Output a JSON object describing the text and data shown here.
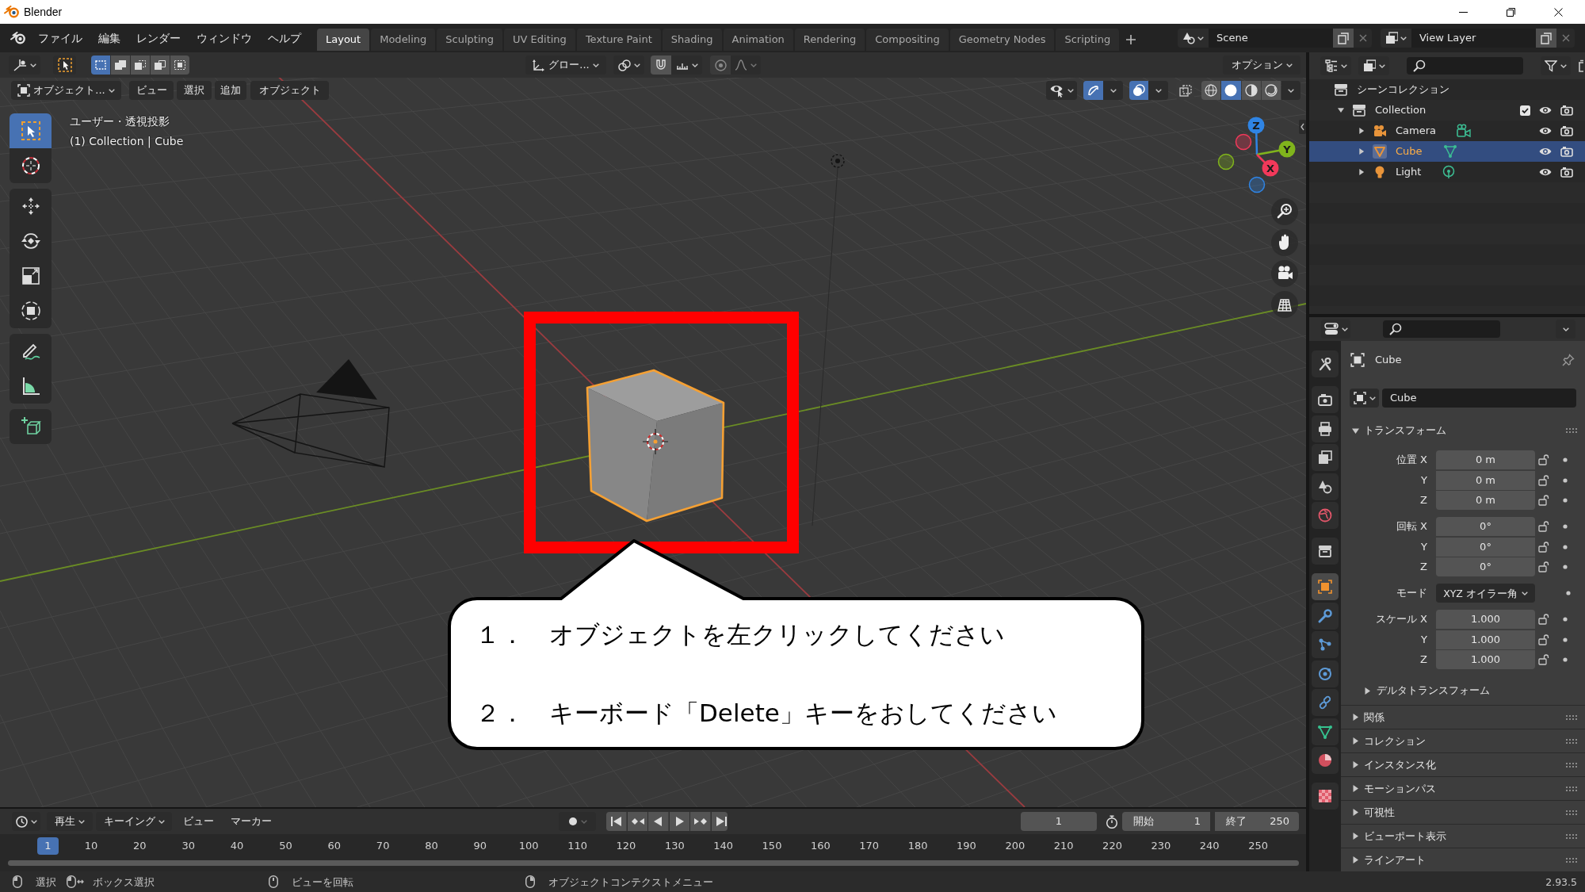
{
  "window": {
    "title": "Blender"
  },
  "menu": [
    "ファイル",
    "編集",
    "レンダー",
    "ウィンドウ",
    "ヘルプ"
  ],
  "workspaces": [
    {
      "label": "Layout",
      "selected": true
    },
    {
      "label": "Modeling",
      "selected": false
    },
    {
      "label": "Sculpting",
      "selected": false
    },
    {
      "label": "UV Editing",
      "selected": false
    },
    {
      "label": "Texture Paint",
      "selected": false
    },
    {
      "label": "Shading",
      "selected": false
    },
    {
      "label": "Animation",
      "selected": false
    },
    {
      "label": "Rendering",
      "selected": false
    },
    {
      "label": "Compositing",
      "selected": false
    },
    {
      "label": "Geometry Nodes",
      "selected": false
    },
    {
      "label": "Scripting",
      "selected": false
    }
  ],
  "scene": "Scene",
  "view_layer": "View Layer",
  "viewport": {
    "select_modes": [
      {
        "selected": true
      },
      {
        "selected": false
      },
      {
        "selected": false
      },
      {
        "selected": false
      },
      {
        "selected": false
      }
    ],
    "orientation": "グロー...",
    "options": "オプション",
    "mode": "オブジェクト...",
    "menus": [
      "ビュー",
      "選択",
      "追加",
      "オブジェクト"
    ],
    "gizmos_on": true,
    "overlays_on": true,
    "xray_on": false,
    "shading": [
      {
        "kind": "wireframe",
        "selected": false
      },
      {
        "kind": "solid",
        "selected": true
      },
      {
        "kind": "material",
        "selected": false
      },
      {
        "kind": "rendered",
        "selected": false
      }
    ],
    "info": [
      "ユーザー・透視投影",
      "(1) Collection | Cube"
    ],
    "tool_groups": [
      {
        "tools": [
          {
            "kind": "select",
            "selected": true
          },
          {
            "kind": "cursor",
            "selected": false
          }
        ]
      },
      {
        "tools": [
          {
            "kind": "move",
            "selected": false
          },
          {
            "kind": "rotate",
            "selected": false
          },
          {
            "kind": "scale",
            "selected": false
          },
          {
            "kind": "transform",
            "selected": false
          }
        ]
      },
      {
        "tools": [
          {
            "kind": "annotate",
            "selected": false
          },
          {
            "kind": "measure",
            "selected": false
          }
        ]
      },
      {
        "tools": [
          {
            "kind": "add-cube",
            "selected": false
          }
        ]
      }
    ],
    "gizmo": [
      {
        "label": "Z",
        "color": "#2f84e4"
      },
      {
        "label": "Y",
        "color": "#80b41c"
      },
      {
        "label": "X",
        "color": "#f2395a"
      }
    ],
    "objects": [
      {
        "kind": "camera",
        "selected": false
      },
      {
        "kind": "light",
        "selected": false
      },
      {
        "kind": "mesh",
        "selected": true
      }
    ],
    "callout": [
      "１．　オブジェクトを左クリックしてください",
      "２．　キーボード「Delete」キーをおしてください"
    ]
  },
  "outliner": {
    "tree": [
      {
        "label": "シーンコレクション",
        "kind": "scene",
        "children": [
          {
            "label": "Collection",
            "kind": "collection",
            "expanded": true,
            "selected": false,
            "checked": true,
            "children": [
              {
                "label": "Camera",
                "kind": "camera",
                "expanded": false,
                "selected": false
              },
              {
                "label": "Cube",
                "kind": "mesh",
                "expanded": false,
                "selected": true
              },
              {
                "label": "Light",
                "kind": "light",
                "expanded": false,
                "selected": false
              }
            ]
          }
        ]
      }
    ]
  },
  "properties": {
    "tab_groups": [
      {
        "tabs": [
          {
            "kind": "tool",
            "selected": false
          }
        ]
      },
      {
        "tabs": [
          {
            "kind": "render",
            "selected": false
          },
          {
            "kind": "output",
            "selected": false
          },
          {
            "kind": "view-layer",
            "selected": false
          },
          {
            "kind": "scene",
            "selected": false
          },
          {
            "kind": "world",
            "selected": false
          }
        ]
      },
      {
        "tabs": [
          {
            "kind": "collection",
            "selected": false
          }
        ]
      },
      {
        "tabs": [
          {
            "kind": "object",
            "selected": true
          },
          {
            "kind": "modifier",
            "selected": false
          },
          {
            "kind": "particles",
            "selected": false
          },
          {
            "kind": "physics",
            "selected": false
          },
          {
            "kind": "constraints",
            "selected": false
          },
          {
            "kind": "data",
            "selected": false
          },
          {
            "kind": "material",
            "selected": false
          }
        ]
      },
      {
        "tabs": [
          {
            "kind": "texture",
            "selected": false
          }
        ]
      }
    ],
    "context": "Cube",
    "object_name": "Cube",
    "transform": {
      "title": "トランスフォーム",
      "expanded": true,
      "groups": [
        {
          "rows": [
            {
              "kind": "number",
              "label": "位置 X",
              "value": "0 m",
              "locked": false
            },
            {
              "kind": "number",
              "label": "Y",
              "value": "0 m",
              "locked": false
            },
            {
              "kind": "number",
              "label": "Z",
              "value": "0 m",
              "locked": false
            }
          ]
        },
        {
          "rows": [
            {
              "kind": "number",
              "label": "回転 X",
              "value": "0°",
              "locked": false
            },
            {
              "kind": "number",
              "label": "Y",
              "value": "0°",
              "locked": false
            },
            {
              "kind": "number",
              "label": "Z",
              "value": "0°",
              "locked": false
            }
          ]
        },
        {
          "rows": [
            {
              "kind": "dropdown",
              "label": "モード",
              "value": "XYZ オイラー角"
            }
          ]
        },
        {
          "rows": [
            {
              "kind": "number",
              "label": "スケール X",
              "value": "1.000",
              "locked": false
            },
            {
              "kind": "number",
              "label": "Y",
              "value": "1.000",
              "locked": false
            },
            {
              "kind": "number",
              "label": "Z",
              "value": "1.000",
              "locked": false
            }
          ]
        }
      ],
      "subpanels": [
        {
          "title": "デルタトランスフォーム",
          "expanded": false
        }
      ]
    },
    "panels": [
      {
        "title": "関係",
        "expanded": false
      },
      {
        "title": "コレクション",
        "expanded": false
      },
      {
        "title": "インスタンス化",
        "expanded": false
      },
      {
        "title": "モーションパス",
        "expanded": false
      },
      {
        "title": "可視性",
        "expanded": false
      },
      {
        "title": "ビューポート表示",
        "expanded": false
      },
      {
        "title": "ラインアート",
        "expanded": false
      }
    ]
  },
  "timeline": {
    "menus": [
      {
        "label": "再生",
        "dropdown": true
      },
      {
        "label": "キーイング",
        "dropdown": true
      },
      {
        "label": "ビュー",
        "dropdown": false
      },
      {
        "label": "マーカー",
        "dropdown": false
      }
    ],
    "current_frame": "1",
    "start": {
      "label": "開始",
      "value": "1"
    },
    "end": {
      "label": "終了",
      "value": "250"
    },
    "playhead": "1",
    "ticks": [
      "10",
      "20",
      "30",
      "40",
      "50",
      "60",
      "70",
      "80",
      "90",
      "100",
      "110",
      "120",
      "130",
      "140",
      "150",
      "160",
      "170",
      "180",
      "190",
      "200",
      "210",
      "220",
      "230",
      "240",
      "250"
    ]
  },
  "status": {
    "hints": [
      {
        "kind": "left",
        "label": "選択"
      },
      {
        "kind": "left-drag",
        "label": "ボックス選択"
      },
      {
        "kind": "middle",
        "label": "ビューを回転"
      },
      {
        "kind": "right",
        "label": "オブジェクトコンテクストメニュー"
      }
    ],
    "version": "2.93.5"
  }
}
